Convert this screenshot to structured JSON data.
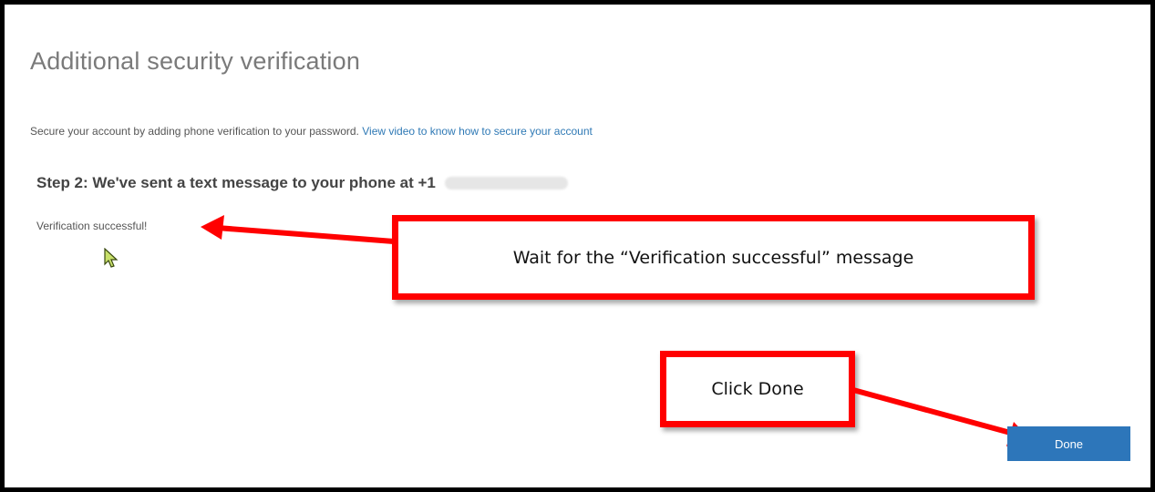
{
  "page": {
    "title": "Additional security verification",
    "intro_text": "Secure your account by adding phone verification to your password.",
    "intro_link": "View video to know how to secure your account",
    "step_heading": "Step 2: We've sent a text message to your phone at +1",
    "status_message": "Verification successful!",
    "done_label": "Done"
  },
  "annotations": {
    "callout_wait": "Wait for the “Verification successful” message",
    "callout_done": "Click Done"
  },
  "colors": {
    "callout_border": "#ff0000",
    "button": "#2d76ba",
    "link": "#2f79b5"
  }
}
